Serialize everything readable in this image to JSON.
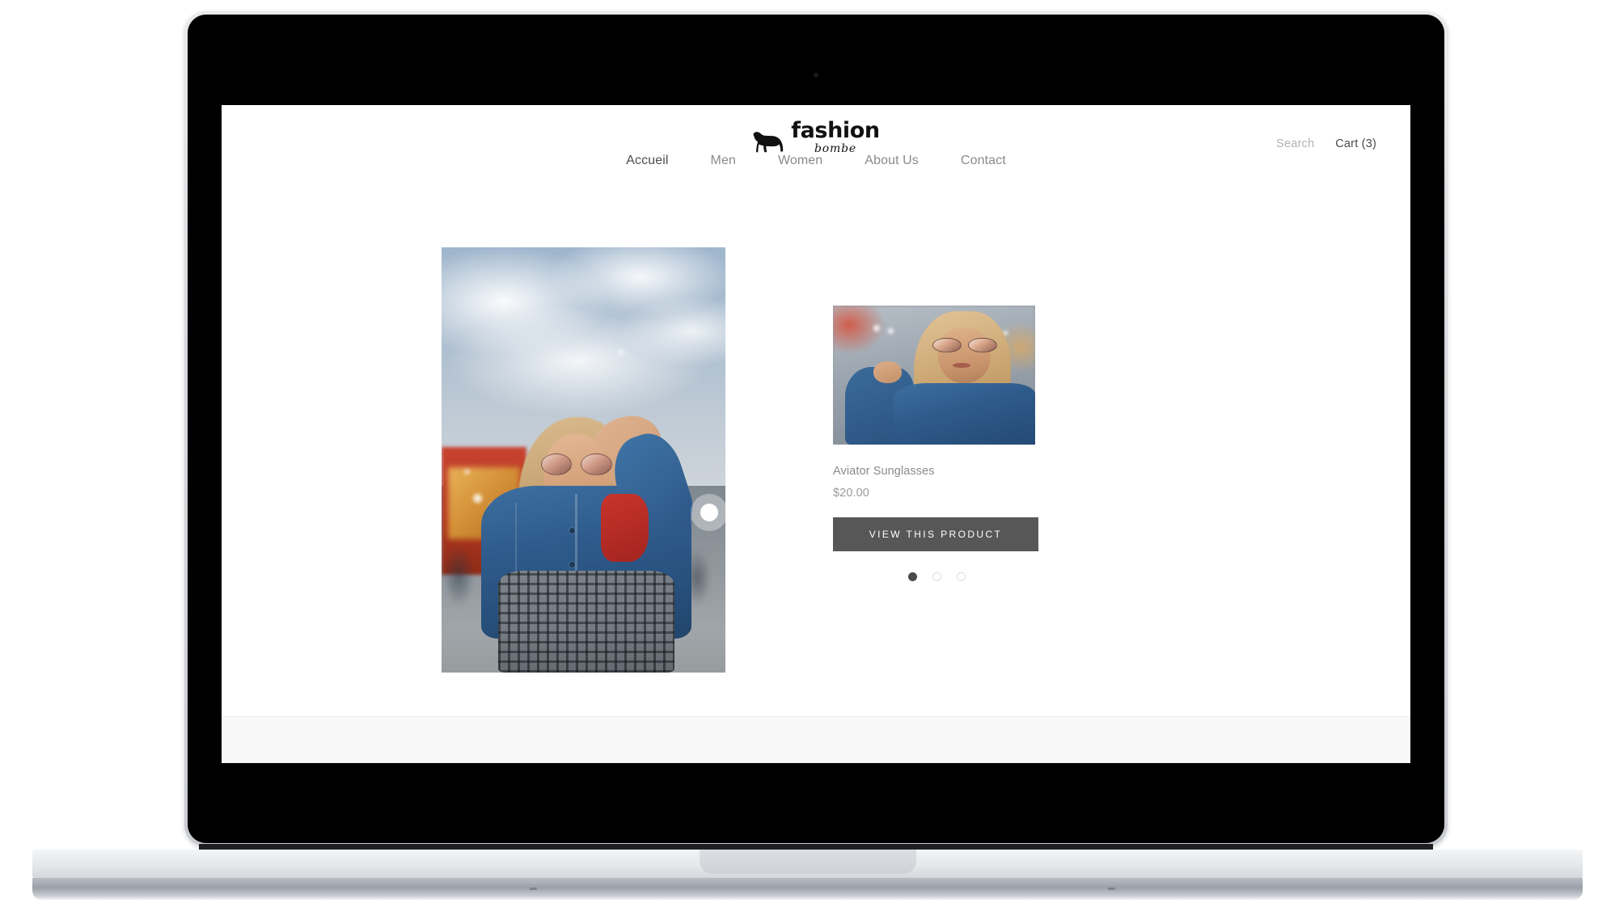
{
  "site": {
    "logo": {
      "icon": "dog-silhouette-icon",
      "word": "fashion",
      "script": "bombe"
    },
    "header": {
      "search_label": "Search",
      "cart_label": "Cart (3)"
    },
    "nav": {
      "items": [
        {
          "label": "Accueil",
          "active": true
        },
        {
          "label": "Men",
          "active": false
        },
        {
          "label": "Women",
          "active": false
        },
        {
          "label": "About Us",
          "active": false
        },
        {
          "label": "Contact",
          "active": false
        }
      ]
    },
    "hero": {
      "alt": "woman-in-denim-jacket-lookbook-photo",
      "hotspots": [
        {
          "id": "hotspot-sunglasses"
        },
        {
          "id": "hotspot-jacket"
        },
        {
          "id": "hotspot-top"
        }
      ]
    },
    "product": {
      "thumbnail_alt": "woman-wearing-aviator-sunglasses",
      "title": "Aviator Sunglasses",
      "price": "$20.00",
      "cta_label": "VIEW THIS PRODUCT"
    },
    "carousel": {
      "dots": [
        {
          "active": true
        },
        {
          "active": false
        },
        {
          "active": false
        }
      ]
    }
  },
  "colors": {
    "cta_background": "#575757",
    "cta_text": "#ffffff",
    "nav_active": "#4f4f4f",
    "nav_inactive": "#8a8a8a",
    "search_text": "#b2b2b2",
    "cart_text": "#4a4a4a",
    "product_text": "#8b8b8b",
    "footer_background": "#f8f8f8",
    "dot_active": "#4a4a4a"
  }
}
